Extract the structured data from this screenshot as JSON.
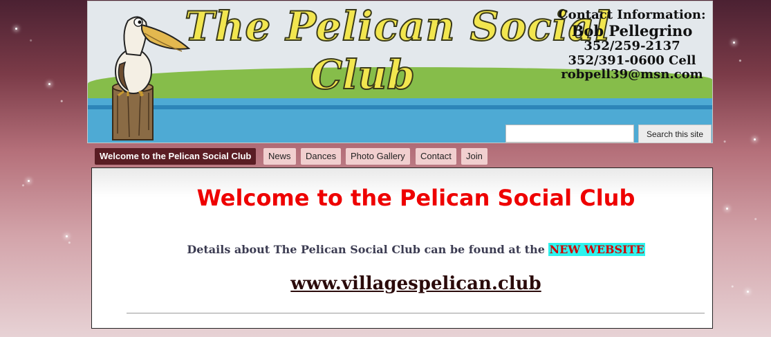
{
  "header": {
    "title_line1": "The Pelican Social",
    "title_line2": "Club",
    "contact": {
      "heading": "Contact Information:",
      "name": "Bob Pellegrino",
      "phone1": "352/259-2137",
      "phone2": "352/391-0600 Cell",
      "email": "robpell39@msn.com"
    }
  },
  "search": {
    "placeholder": "",
    "button_label": "Search this site"
  },
  "nav": {
    "items": [
      {
        "label": "Welcome to the Pelican Social Club",
        "active": true
      },
      {
        "label": "News"
      },
      {
        "label": "Dances"
      },
      {
        "label": "Photo Gallery"
      },
      {
        "label": "Contact"
      },
      {
        "label": "Join"
      }
    ]
  },
  "main": {
    "title": "Welcome to the Pelican Social Club",
    "details_text": "Details about The Pelican Social Club can be found at the",
    "details_link": "NEW WEBSITE",
    "site_link": "www.villagespelican.club"
  },
  "colors": {
    "title_red": "#ee0000",
    "nav_active": "#5a1d24",
    "nav_inactive": "#f1cfcf",
    "highlight": "#2ef3ee"
  }
}
